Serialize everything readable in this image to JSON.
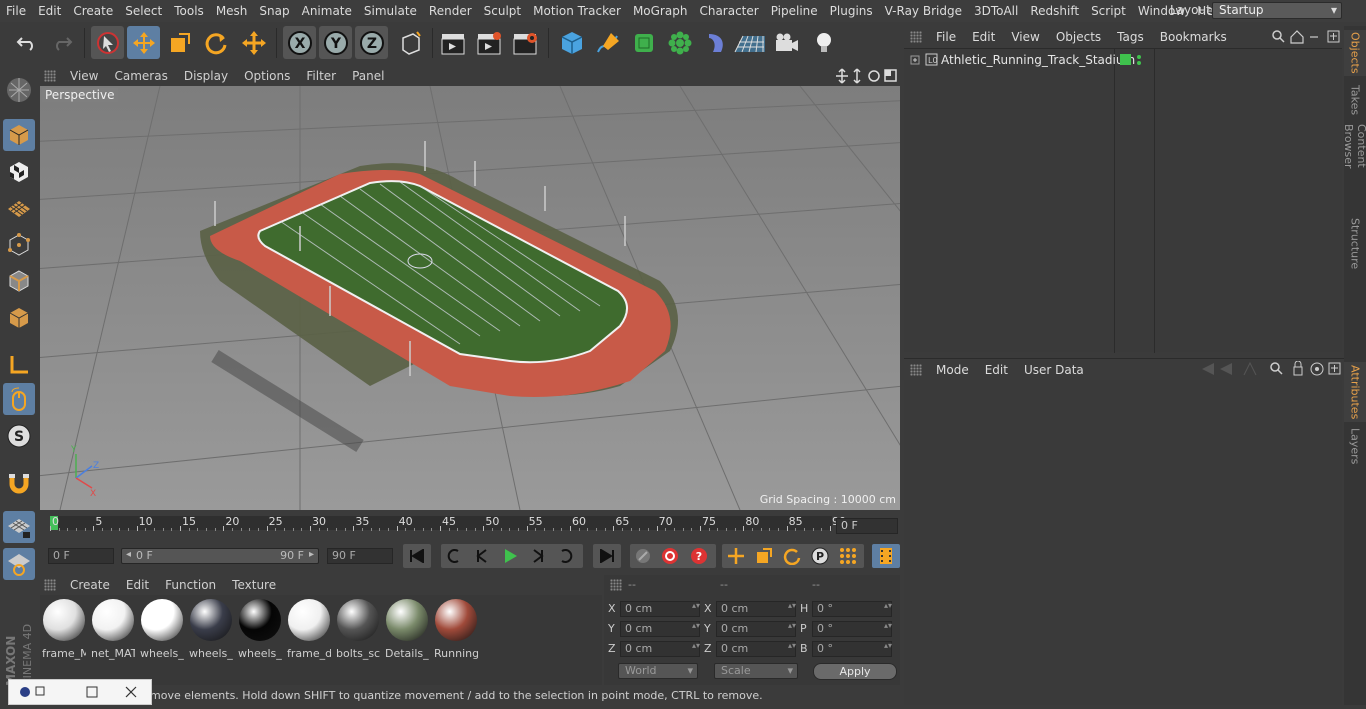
{
  "menubar": {
    "items": [
      "File",
      "Edit",
      "Create",
      "Select",
      "Tools",
      "Mesh",
      "Snap",
      "Animate",
      "Simulate",
      "Render",
      "Sculpt",
      "Motion Tracker",
      "MoGraph",
      "Character",
      "Pipeline",
      "Plugins",
      "V-Ray Bridge",
      "3DToAll",
      "Redshift",
      "Script",
      "Window",
      "Help"
    ],
    "layout_label": "Layout:",
    "layout_value": "Startup"
  },
  "viewport": {
    "menu": [
      "View",
      "Cameras",
      "Display",
      "Options",
      "Filter",
      "Panel"
    ],
    "camera_label": "Perspective",
    "grid_spacing": "Grid Spacing : 10000 cm"
  },
  "timeline": {
    "ticks": [
      "0",
      "5",
      "10",
      "15",
      "20",
      "25",
      "30",
      "35",
      "40",
      "45",
      "50",
      "55",
      "60",
      "65",
      "70",
      "75",
      "80",
      "85",
      "90"
    ],
    "current_frame": "0 F"
  },
  "transport": {
    "start_field": "0 F",
    "range_start": "0 F",
    "range_end": "90 F",
    "end_field": "90 F"
  },
  "materials": {
    "menu": [
      "Create",
      "Edit",
      "Function",
      "Texture"
    ],
    "items": [
      {
        "label": "frame_M",
        "color": "#e0e0e0"
      },
      {
        "label": "net_MAT",
        "color": "#f2f2f2"
      },
      {
        "label": "wheels_",
        "color": "#ffffff"
      },
      {
        "label": "wheels_",
        "color": "#3a3d4a"
      },
      {
        "label": "wheels_",
        "color": "#050505"
      },
      {
        "label": "frame_d",
        "color": "#f0f0f0"
      },
      {
        "label": "bolts_sc",
        "color": "#555555"
      },
      {
        "label": "Details_",
        "color": "#7a8a6a"
      },
      {
        "label": "Running",
        "color": "#a04a3a"
      }
    ]
  },
  "coords": {
    "headers": [
      "--",
      "--",
      "--"
    ],
    "rows": [
      {
        "a": "X",
        "av": "0 cm",
        "b": "X",
        "bv": "0 cm",
        "c": "H",
        "cv": "0 °"
      },
      {
        "a": "Y",
        "av": "0 cm",
        "b": "Y",
        "bv": "0 cm",
        "c": "P",
        "cv": "0 °"
      },
      {
        "a": "Z",
        "av": "0 cm",
        "b": "Z",
        "bv": "0 cm",
        "c": "B",
        "cv": "0 °"
      }
    ],
    "mode": "World",
    "type": "Scale",
    "apply": "Apply"
  },
  "status": "move elements. Hold down SHIFT to quantize movement / add to the selection in point mode, CTRL to remove.",
  "objects": {
    "menu": [
      "File",
      "Edit",
      "View",
      "Objects",
      "Tags",
      "Bookmarks"
    ],
    "items": [
      {
        "name": "Athletic_Running_Track_Stadium"
      }
    ]
  },
  "attributes": {
    "menu": [
      "Mode",
      "Edit",
      "User Data"
    ]
  },
  "sidetabs": [
    "Objects",
    "Takes",
    "Content Browser",
    "Structure",
    "Attributes",
    "Layers"
  ],
  "branding": {
    "maxon": "MAXON",
    "product": "CINEMA 4D"
  },
  "colors": {
    "accent": "#5e7fa3",
    "track": "#c85a48",
    "field": "#3f6b2e",
    "tab_active": "#e8a14a"
  }
}
